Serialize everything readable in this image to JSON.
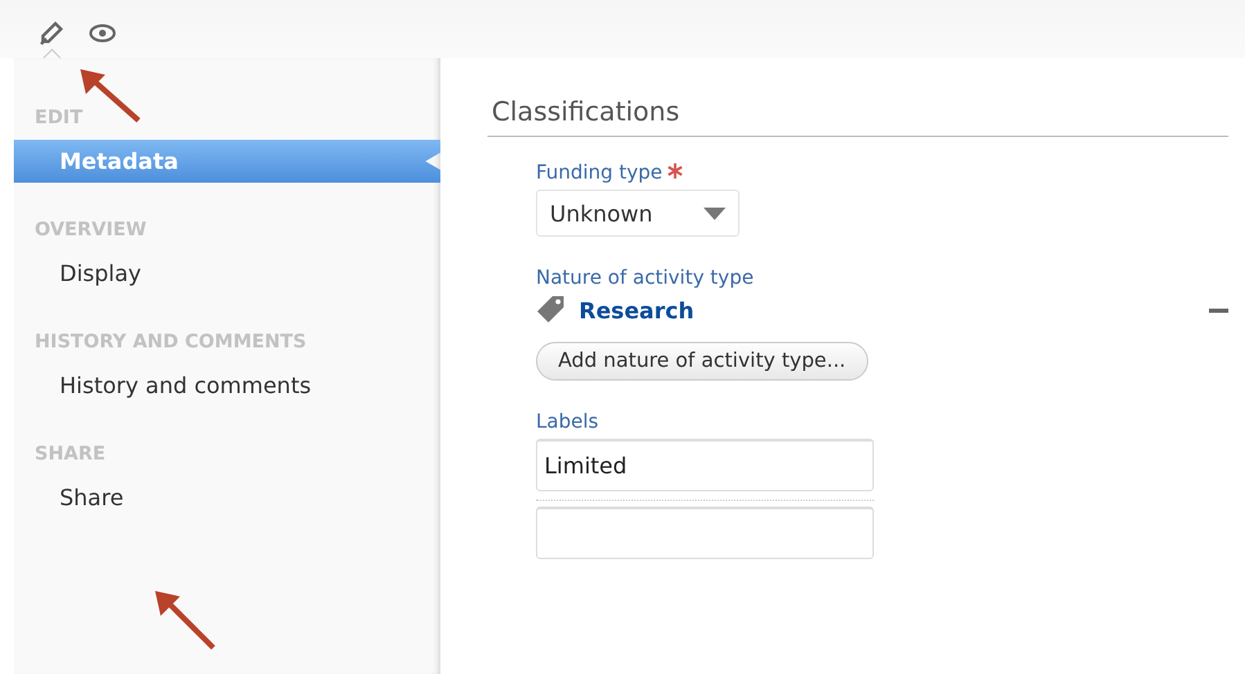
{
  "toolbar": [
    {
      "kind": "edit",
      "selected": true
    },
    {
      "kind": "view",
      "selected": false
    }
  ],
  "sidebar": {
    "sections": [
      {
        "heading": "EDIT",
        "items": [
          {
            "label": "Metadata",
            "selected": true
          }
        ]
      },
      {
        "heading": "OVERVIEW",
        "items": [
          {
            "label": "Display",
            "selected": false
          }
        ]
      },
      {
        "heading": "HISTORY AND COMMENTS",
        "items": [
          {
            "label": "History and comments",
            "selected": false
          }
        ]
      },
      {
        "heading": "SHARE",
        "items": [
          {
            "label": "Share",
            "selected": false
          }
        ]
      }
    ]
  },
  "main": {
    "title": "Classifications",
    "funding_type": {
      "label": "Funding type",
      "required": true,
      "value": "Unknown"
    },
    "nature_of_activity": {
      "label": "Nature of activity type",
      "tags": [
        {
          "label": "Research",
          "removable": true
        }
      ],
      "add_button": "Add nature of activity type..."
    },
    "labels": {
      "label": "Labels",
      "values": [
        "Limited"
      ]
    }
  }
}
